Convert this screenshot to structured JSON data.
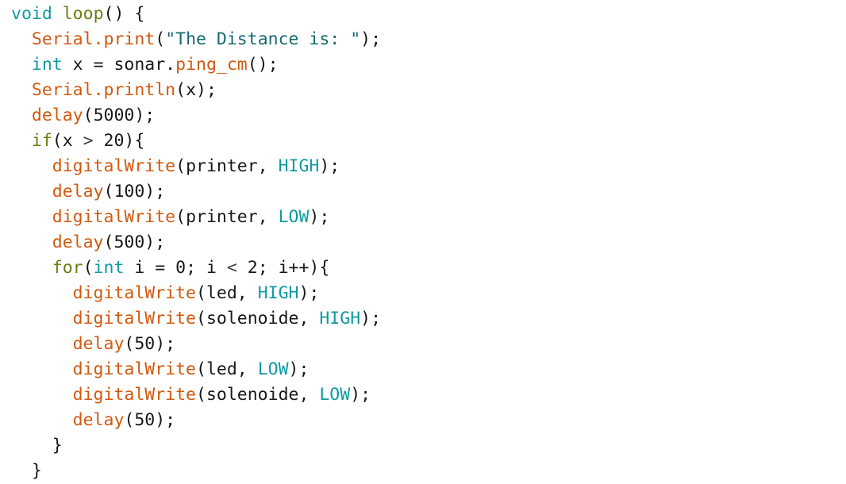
{
  "editor": {
    "language": "arduino-cpp",
    "background_color": "#ffffff",
    "font_size_px": 21.5,
    "line_height_px": 32,
    "indent_unit_spaces": 2
  },
  "palette": {
    "plain": "#18181a",
    "keyword_type": "#0f9ba2",
    "control_flow": "#6a7d12",
    "function_call": "#d2590f",
    "string_literal": "#176a72",
    "operator": "#3f4447"
  },
  "code": {
    "full_text": "void loop() {\n  Serial.print(\"The Distance is: \");\n  int x = sonar.ping_cm();\n  Serial.println(x);\n  delay(5000);\n  if(x > 20){\n    digitalWrite(printer, HIGH);\n    delay(100);\n    digitalWrite(printer, LOW);\n    delay(500);\n    for(int i = 0; i < 2; i++){\n      digitalWrite(led, HIGH);\n      digitalWrite(solenoide, HIGH);\n      delay(50);\n      digitalWrite(led, LOW);\n      digitalWrite(solenoide, LOW);\n      delay(50);\n    }\n  }",
    "lines": [
      {
        "n": 1,
        "indent": 0,
        "text": "void loop() {"
      },
      {
        "n": 2,
        "indent": 2,
        "text": "Serial.print(\"The Distance is: \");"
      },
      {
        "n": 3,
        "indent": 2,
        "text": "int x = sonar.ping_cm();"
      },
      {
        "n": 4,
        "indent": 2,
        "text": "Serial.println(x);"
      },
      {
        "n": 5,
        "indent": 2,
        "text": "delay(5000);"
      },
      {
        "n": 6,
        "indent": 2,
        "text": "if(x > 20){"
      },
      {
        "n": 7,
        "indent": 4,
        "text": "digitalWrite(printer, HIGH);"
      },
      {
        "n": 8,
        "indent": 4,
        "text": "delay(100);"
      },
      {
        "n": 9,
        "indent": 4,
        "text": "digitalWrite(printer, LOW);"
      },
      {
        "n": 10,
        "indent": 4,
        "text": "delay(500);"
      },
      {
        "n": 11,
        "indent": 4,
        "text": "for(int i = 0; i < 2; i++){"
      },
      {
        "n": 12,
        "indent": 6,
        "text": "digitalWrite(led, HIGH);"
      },
      {
        "n": 13,
        "indent": 6,
        "text": "digitalWrite(solenoide, HIGH);"
      },
      {
        "n": 14,
        "indent": 6,
        "text": "delay(50);"
      },
      {
        "n": 15,
        "indent": 6,
        "text": "digitalWrite(led, LOW);"
      },
      {
        "n": 16,
        "indent": 6,
        "text": "digitalWrite(solenoide, LOW);"
      },
      {
        "n": 17,
        "indent": 6,
        "text": "delay(50);"
      },
      {
        "n": 18,
        "indent": 4,
        "text": "}"
      },
      {
        "n": 19,
        "indent": 2,
        "text": "}"
      }
    ]
  },
  "tokens": {
    "line1": [
      {
        "t": "void",
        "c": "kw"
      },
      {
        "t": " ",
        "c": "plain"
      },
      {
        "t": "loop",
        "c": "ctrl"
      },
      {
        "t": "() {",
        "c": "punct"
      }
    ],
    "line2": [
      {
        "t": "Serial",
        "c": "fn"
      },
      {
        "t": ".",
        "c": "fn"
      },
      {
        "t": "print",
        "c": "fn"
      },
      {
        "t": "(",
        "c": "punct"
      },
      {
        "t": "\"The Distance is: \"",
        "c": "str"
      },
      {
        "t": ");",
        "c": "punct"
      }
    ],
    "line3": [
      {
        "t": "int",
        "c": "kw"
      },
      {
        "t": " x = sonar.",
        "c": "plain"
      },
      {
        "t": "ping_cm",
        "c": "fn"
      },
      {
        "t": "();",
        "c": "punct"
      }
    ],
    "line4": [
      {
        "t": "Serial",
        "c": "fn"
      },
      {
        "t": ".",
        "c": "fn"
      },
      {
        "t": "println",
        "c": "fn"
      },
      {
        "t": "(x);",
        "c": "punct"
      }
    ],
    "line5": [
      {
        "t": "delay",
        "c": "fn"
      },
      {
        "t": "(5000);",
        "c": "punct"
      }
    ],
    "line6": [
      {
        "t": "if",
        "c": "ctrl"
      },
      {
        "t": "(x ",
        "c": "punct"
      },
      {
        "t": ">",
        "c": "op"
      },
      {
        "t": " 20){",
        "c": "punct"
      }
    ],
    "line7": [
      {
        "t": "digitalWrite",
        "c": "fn"
      },
      {
        "t": "(printer, ",
        "c": "punct"
      },
      {
        "t": "HIGH",
        "c": "kw"
      },
      {
        "t": ");",
        "c": "punct"
      }
    ],
    "line8": [
      {
        "t": "delay",
        "c": "fn"
      },
      {
        "t": "(100);",
        "c": "punct"
      }
    ],
    "line9": [
      {
        "t": "digitalWrite",
        "c": "fn"
      },
      {
        "t": "(printer, ",
        "c": "punct"
      },
      {
        "t": "LOW",
        "c": "kw"
      },
      {
        "t": ");",
        "c": "punct"
      }
    ],
    "line10": [
      {
        "t": "delay",
        "c": "fn"
      },
      {
        "t": "(500);",
        "c": "punct"
      }
    ],
    "line11": [
      {
        "t": "for",
        "c": "ctrl"
      },
      {
        "t": "(",
        "c": "punct"
      },
      {
        "t": "int",
        "c": "kw"
      },
      {
        "t": " i = 0; i ",
        "c": "plain"
      },
      {
        "t": "<",
        "c": "op"
      },
      {
        "t": " 2; i++){",
        "c": "plain"
      }
    ],
    "line12": [
      {
        "t": "digitalWrite",
        "c": "fn"
      },
      {
        "t": "(led, ",
        "c": "punct"
      },
      {
        "t": "HIGH",
        "c": "kw"
      },
      {
        "t": ");",
        "c": "punct"
      }
    ],
    "line13": [
      {
        "t": "digitalWrite",
        "c": "fn"
      },
      {
        "t": "(solenoide, ",
        "c": "punct"
      },
      {
        "t": "HIGH",
        "c": "kw"
      },
      {
        "t": ");",
        "c": "punct"
      }
    ],
    "line14": [
      {
        "t": "delay",
        "c": "fn"
      },
      {
        "t": "(50);",
        "c": "punct"
      }
    ],
    "line15": [
      {
        "t": "digitalWrite",
        "c": "fn"
      },
      {
        "t": "(led, ",
        "c": "punct"
      },
      {
        "t": "LOW",
        "c": "kw"
      },
      {
        "t": ");",
        "c": "punct"
      }
    ],
    "line16": [
      {
        "t": "digitalWrite",
        "c": "fn"
      },
      {
        "t": "(solenoide, ",
        "c": "punct"
      },
      {
        "t": "LOW",
        "c": "kw"
      },
      {
        "t": ");",
        "c": "punct"
      }
    ],
    "line17": [
      {
        "t": "delay",
        "c": "fn"
      },
      {
        "t": "(50);",
        "c": "punct"
      }
    ],
    "line18": [
      {
        "t": "}",
        "c": "punct"
      }
    ],
    "line19": [
      {
        "t": "}",
        "c": "punct"
      }
    ]
  }
}
